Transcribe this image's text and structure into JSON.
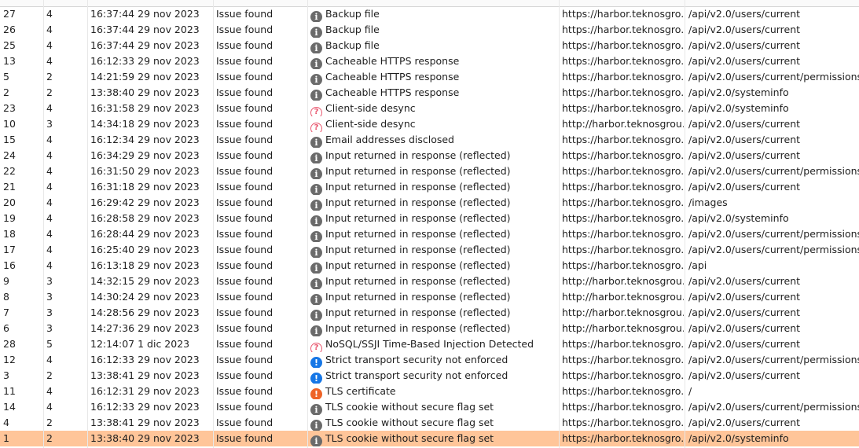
{
  "colors": {
    "selected_row": "#ffc599",
    "info_icon": "#6b6b6b",
    "question_icon": "#e8536b",
    "high_icon_blue": "#1677e6",
    "high_icon_orange": "#ee6327"
  },
  "rows": [
    {
      "id": "27",
      "severity": "4",
      "time": "16:37:44 29 nov 2023",
      "status": "Issue found",
      "icon": "info-icon",
      "type": "Backup file",
      "host": "https://harbor.teknosgro...",
      "path": "/api/v2.0/users/current"
    },
    {
      "id": "26",
      "severity": "4",
      "time": "16:37:44 29 nov 2023",
      "status": "Issue found",
      "icon": "info-icon",
      "type": "Backup file",
      "host": "https://harbor.teknosgro...",
      "path": "/api/v2.0/users/current"
    },
    {
      "id": "25",
      "severity": "4",
      "time": "16:37:44 29 nov 2023",
      "status": "Issue found",
      "icon": "info-icon",
      "type": "Backup file",
      "host": "https://harbor.teknosgro...",
      "path": "/api/v2.0/users/current"
    },
    {
      "id": "13",
      "severity": "4",
      "time": "16:12:33 29 nov 2023",
      "status": "Issue found",
      "icon": "info-icon",
      "type": "Cacheable HTTPS response",
      "host": "https://harbor.teknosgro...",
      "path": "/api/v2.0/users/current"
    },
    {
      "id": "5",
      "severity": "2",
      "time": "14:21:59 29 nov 2023",
      "status": "Issue found",
      "icon": "info-icon",
      "type": "Cacheable HTTPS response",
      "host": "https://harbor.teknosgro...",
      "path": "/api/v2.0/users/current/permissions"
    },
    {
      "id": "2",
      "severity": "2",
      "time": "13:38:40 29 nov 2023",
      "status": "Issue found",
      "icon": "info-icon",
      "type": "Cacheable HTTPS response",
      "host": "https://harbor.teknosgro...",
      "path": "/api/v2.0/systeminfo"
    },
    {
      "id": "23",
      "severity": "4",
      "time": "16:31:58 29 nov 2023",
      "status": "Issue found",
      "icon": "question-icon",
      "type": "Client-side desync",
      "host": "https://harbor.teknosgro...",
      "path": "/api/v2.0/systeminfo"
    },
    {
      "id": "10",
      "severity": "3",
      "time": "14:34:18 29 nov 2023",
      "status": "Issue found",
      "icon": "question-icon",
      "type": "Client-side desync",
      "host": "http://harbor.teknosgrou...",
      "path": "/api/v2.0/users/current"
    },
    {
      "id": "15",
      "severity": "4",
      "time": "16:12:34 29 nov 2023",
      "status": "Issue found",
      "icon": "info-icon",
      "type": "Email addresses disclosed",
      "host": "https://harbor.teknosgro...",
      "path": "/api/v2.0/users/current"
    },
    {
      "id": "24",
      "severity": "4",
      "time": "16:34:29 29 nov 2023",
      "status": "Issue found",
      "icon": "info-icon",
      "type": "Input returned in response (reflected)",
      "host": "https://harbor.teknosgro...",
      "path": "/api/v2.0/users/current"
    },
    {
      "id": "22",
      "severity": "4",
      "time": "16:31:50 29 nov 2023",
      "status": "Issue found",
      "icon": "info-icon",
      "type": "Input returned in response (reflected)",
      "host": "https://harbor.teknosgro...",
      "path": "/api/v2.0/users/current/permissions"
    },
    {
      "id": "21",
      "severity": "4",
      "time": "16:31:18 29 nov 2023",
      "status": "Issue found",
      "icon": "info-icon",
      "type": "Input returned in response (reflected)",
      "host": "https://harbor.teknosgro...",
      "path": "/api/v2.0/users/current"
    },
    {
      "id": "20",
      "severity": "4",
      "time": "16:29:42 29 nov 2023",
      "status": "Issue found",
      "icon": "info-icon",
      "type": "Input returned in response (reflected)",
      "host": "https://harbor.teknosgro...",
      "path": "/images"
    },
    {
      "id": "19",
      "severity": "4",
      "time": "16:28:58 29 nov 2023",
      "status": "Issue found",
      "icon": "info-icon",
      "type": "Input returned in response (reflected)",
      "host": "https://harbor.teknosgro...",
      "path": "/api/v2.0/systeminfo"
    },
    {
      "id": "18",
      "severity": "4",
      "time": "16:28:44 29 nov 2023",
      "status": "Issue found",
      "icon": "info-icon",
      "type": "Input returned in response (reflected)",
      "host": "https://harbor.teknosgro...",
      "path": "/api/v2.0/users/current/permissions"
    },
    {
      "id": "17",
      "severity": "4",
      "time": "16:25:40 29 nov 2023",
      "status": "Issue found",
      "icon": "info-icon",
      "type": "Input returned in response (reflected)",
      "host": "https://harbor.teknosgro...",
      "path": "/api/v2.0/users/current/permissions"
    },
    {
      "id": "16",
      "severity": "4",
      "time": "16:13:18 29 nov 2023",
      "status": "Issue found",
      "icon": "info-icon",
      "type": "Input returned in response (reflected)",
      "host": "https://harbor.teknosgro...",
      "path": "/api"
    },
    {
      "id": "9",
      "severity": "3",
      "time": "14:32:15 29 nov 2023",
      "status": "Issue found",
      "icon": "info-icon",
      "type": "Input returned in response (reflected)",
      "host": "http://harbor.teknosgrou...",
      "path": "/api/v2.0/users/current"
    },
    {
      "id": "8",
      "severity": "3",
      "time": "14:30:24 29 nov 2023",
      "status": "Issue found",
      "icon": "info-icon",
      "type": "Input returned in response (reflected)",
      "host": "http://harbor.teknosgrou...",
      "path": "/api/v2.0/users/current"
    },
    {
      "id": "7",
      "severity": "3",
      "time": "14:28:56 29 nov 2023",
      "status": "Issue found",
      "icon": "info-icon",
      "type": "Input returned in response (reflected)",
      "host": "http://harbor.teknosgrou...",
      "path": "/api/v2.0/users/current"
    },
    {
      "id": "6",
      "severity": "3",
      "time": "14:27:36 29 nov 2023",
      "status": "Issue found",
      "icon": "info-icon",
      "type": "Input returned in response (reflected)",
      "host": "http://harbor.teknosgrou...",
      "path": "/api/v2.0/users/current"
    },
    {
      "id": "28",
      "severity": "5",
      "time": "12:14:07 1 dic 2023",
      "status": "Issue found",
      "icon": "question-icon",
      "type": "NoSQL/SSJI Time-Based Injection Detected",
      "host": "https://harbor.teknosgro...",
      "path": "/api/v2.0/users/current"
    },
    {
      "id": "12",
      "severity": "4",
      "time": "16:12:33 29 nov 2023",
      "status": "Issue found",
      "icon": "exclaim-blue-icon",
      "type": "Strict transport security not enforced",
      "host": "https://harbor.teknosgro...",
      "path": "/api/v2.0/users/current/permissions"
    },
    {
      "id": "3",
      "severity": "2",
      "time": "13:38:41 29 nov 2023",
      "status": "Issue found",
      "icon": "exclaim-blue-icon",
      "type": "Strict transport security not enforced",
      "host": "https://harbor.teknosgro...",
      "path": "/api/v2.0/users/current"
    },
    {
      "id": "11",
      "severity": "4",
      "time": "16:12:31 29 nov 2023",
      "status": "Issue found",
      "icon": "exclaim-orange-icon",
      "type": "TLS certificate",
      "host": "https://harbor.teknosgro...",
      "path": "/"
    },
    {
      "id": "14",
      "severity": "4",
      "time": "16:12:33 29 nov 2023",
      "status": "Issue found",
      "icon": "info-icon",
      "type": "TLS cookie without secure flag set",
      "host": "https://harbor.teknosgro...",
      "path": "/api/v2.0/users/current/permissions"
    },
    {
      "id": "4",
      "severity": "2",
      "time": "13:38:41 29 nov 2023",
      "status": "Issue found",
      "icon": "info-icon",
      "type": "TLS cookie without secure flag set",
      "host": "https://harbor.teknosgro...",
      "path": "/api/v2.0/users/current"
    },
    {
      "id": "1",
      "severity": "2",
      "time": "13:38:40 29 nov 2023",
      "status": "Issue found",
      "icon": "info-icon",
      "type": "TLS cookie without secure flag set",
      "host": "https://harbor.teknosgro...",
      "path": "/api/v2.0/systeminfo",
      "selected": true
    }
  ]
}
